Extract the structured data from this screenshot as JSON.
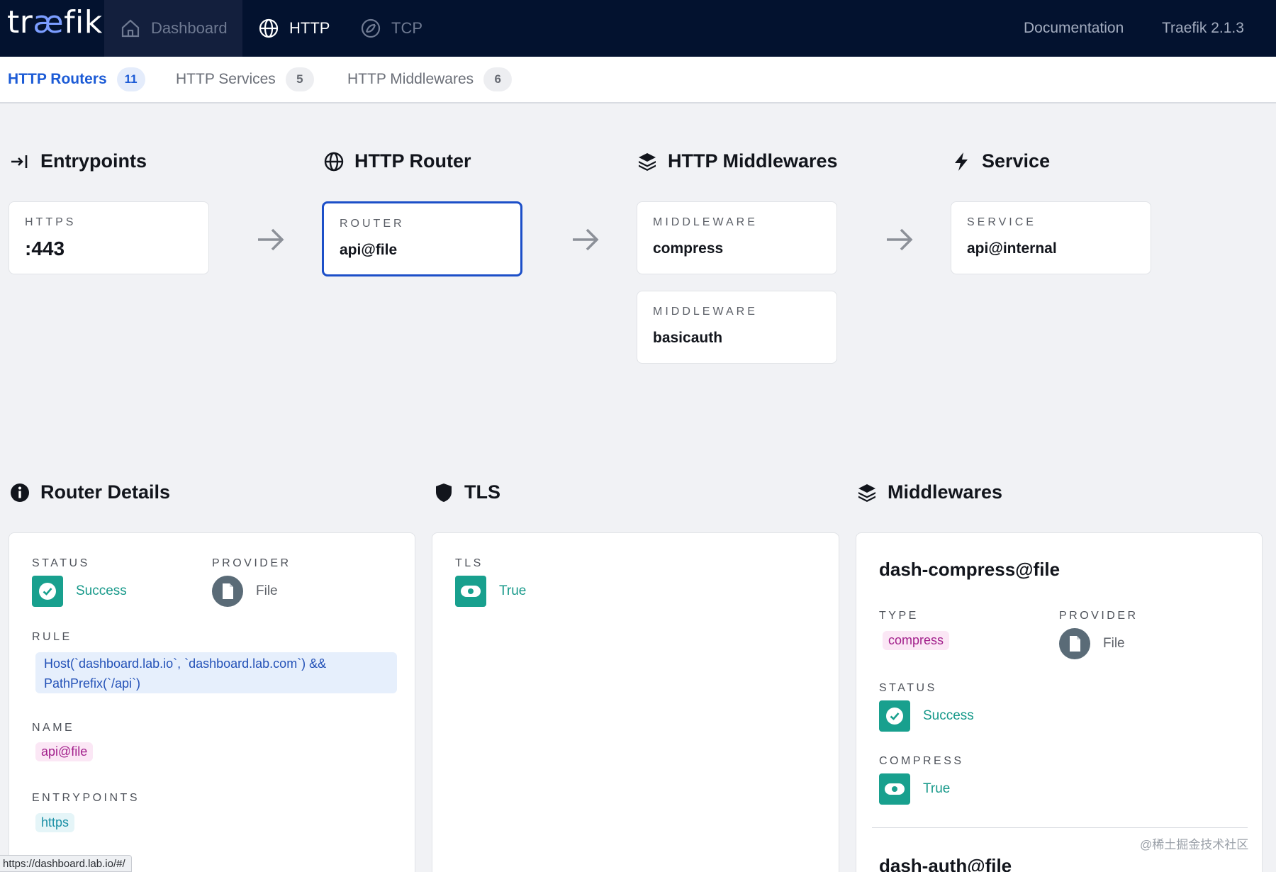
{
  "topbar": {
    "logo_prefix": "tr",
    "logo_ae": "æ",
    "logo_suffix": "fik",
    "nav": [
      {
        "label": "Dashboard",
        "icon": "home-icon"
      },
      {
        "label": "HTTP",
        "icon": "globe-icon"
      },
      {
        "label": "TCP",
        "icon": "tcp-icon"
      }
    ],
    "documentation": "Documentation",
    "version": "Traefik 2.1.3"
  },
  "subtabs": [
    {
      "label": "HTTP Routers",
      "count": "11"
    },
    {
      "label": "HTTP Services",
      "count": "5"
    },
    {
      "label": "HTTP Middlewares",
      "count": "6"
    }
  ],
  "flow": {
    "entrypoints": {
      "title": "Entrypoints",
      "card_label": "HTTPS",
      "card_value": ":443"
    },
    "router": {
      "title": "HTTP Router",
      "card_label": "ROUTER",
      "card_value": "api@file"
    },
    "middlewares": {
      "title": "HTTP Middlewares",
      "cards": [
        {
          "label": "MIDDLEWARE",
          "value": "compress"
        },
        {
          "label": "MIDDLEWARE",
          "value": "basicauth"
        }
      ]
    },
    "service": {
      "title": "Service",
      "card_label": "SERVICE",
      "card_value": "api@internal"
    }
  },
  "router_details": {
    "title": "Router Details",
    "status_label": "STATUS",
    "status_value": "Success",
    "provider_label": "PROVIDER",
    "provider_value": "File",
    "rule_label": "RULE",
    "rule_line1": "Host(`dashboard.lab.io`, `dashboard.lab.com`) &&",
    "rule_line2": "PathPrefix(`/api`)",
    "name_label": "NAME",
    "name_value": "api@file",
    "entrypoints_label": "ENTRYPOINTS",
    "entrypoints_value": "https"
  },
  "tls": {
    "title": "TLS",
    "label": "TLS",
    "value": "True"
  },
  "middlewares_panel": {
    "title": "Middlewares",
    "items": [
      {
        "name": "dash-compress@file",
        "type_label": "TYPE",
        "type_value": "compress",
        "provider_label": "PROVIDER",
        "provider_value": "File",
        "status_label": "STATUS",
        "status_value": "Success",
        "compress_label": "COMPRESS",
        "compress_value": "True"
      },
      {
        "name": "dash-auth@file"
      }
    ]
  },
  "statusbar_url": "https://dashboard.lab.io/#/",
  "watermark": "@稀土掘金技术社区",
  "colors": {
    "topbar": "#03122f",
    "accent_blue": "#1c5bd6",
    "teal": "#18a08e",
    "pink_tag": "#a21f8b"
  }
}
